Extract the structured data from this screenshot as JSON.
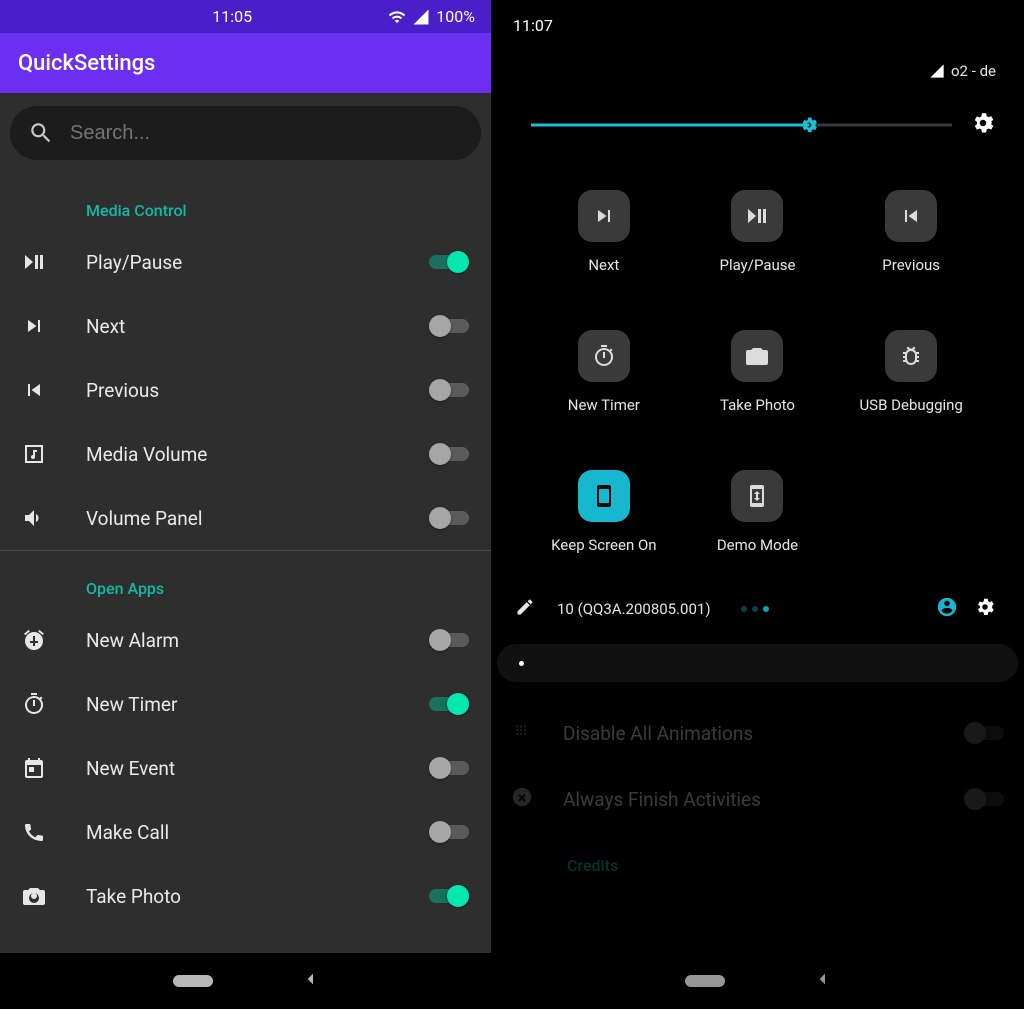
{
  "left": {
    "status": {
      "time": "11:05",
      "battery": "100%"
    },
    "app_title": "QuickSettings",
    "search_placeholder": "Search...",
    "sections": {
      "media_control": {
        "title": "Media Control",
        "items": [
          {
            "id": "play-pause",
            "label": "Play/Pause",
            "on": true,
            "icon": "play-pause-icon"
          },
          {
            "id": "next",
            "label": "Next",
            "on": false,
            "icon": "skip-next-icon"
          },
          {
            "id": "previous",
            "label": "Previous",
            "on": false,
            "icon": "skip-previous-icon"
          },
          {
            "id": "media-volume",
            "label": "Media Volume",
            "on": false,
            "icon": "music-note-box-icon"
          },
          {
            "id": "volume-panel",
            "label": "Volume Panel",
            "on": false,
            "icon": "volume-icon"
          }
        ]
      },
      "open_apps": {
        "title": "Open Apps",
        "items": [
          {
            "id": "new-alarm",
            "label": "New Alarm",
            "on": false,
            "icon": "alarm-add-icon"
          },
          {
            "id": "new-timer",
            "label": "New Timer",
            "on": true,
            "icon": "timer-icon"
          },
          {
            "id": "new-event",
            "label": "New Event",
            "on": false,
            "icon": "event-icon"
          },
          {
            "id": "make-call",
            "label": "Make Call",
            "on": false,
            "icon": "phone-icon"
          },
          {
            "id": "take-photo",
            "label": "Take Photo",
            "on": true,
            "icon": "camera-icon"
          }
        ]
      }
    }
  },
  "right": {
    "status": {
      "time": "11:07",
      "carrier": "o2 - de"
    },
    "brightness_percent": 66,
    "tiles": [
      {
        "id": "next",
        "label": "Next",
        "icon": "skip-next-icon",
        "active": false
      },
      {
        "id": "play-pause",
        "label": "Play/Pause",
        "icon": "play-pause-icon",
        "active": false
      },
      {
        "id": "previous",
        "label": "Previous",
        "icon": "skip-previous-icon",
        "active": false
      },
      {
        "id": "new-timer",
        "label": "New Timer",
        "icon": "timer-icon",
        "active": false
      },
      {
        "id": "take-photo",
        "label": "Take Photo",
        "icon": "camera-icon",
        "active": false
      },
      {
        "id": "usb-debugging",
        "label": "USB Debugging",
        "icon": "bug-icon",
        "active": false
      },
      {
        "id": "keep-screen-on",
        "label": "Keep Screen On",
        "icon": "smartphone-icon",
        "active": true
      },
      {
        "id": "demo-mode",
        "label": "Demo Mode",
        "icon": "device-sync-icon",
        "active": false
      }
    ],
    "footer": {
      "version": "10 (QQ3A.200805.001)"
    },
    "dimmed": {
      "items": [
        {
          "id": "disable-animations",
          "label": "Disable All Animations",
          "icon": "blur-icon",
          "on": false
        },
        {
          "id": "always-finish",
          "label": "Always Finish Activities",
          "icon": "close-circle-icon",
          "on": false
        }
      ],
      "credits_title": "Credits"
    }
  }
}
